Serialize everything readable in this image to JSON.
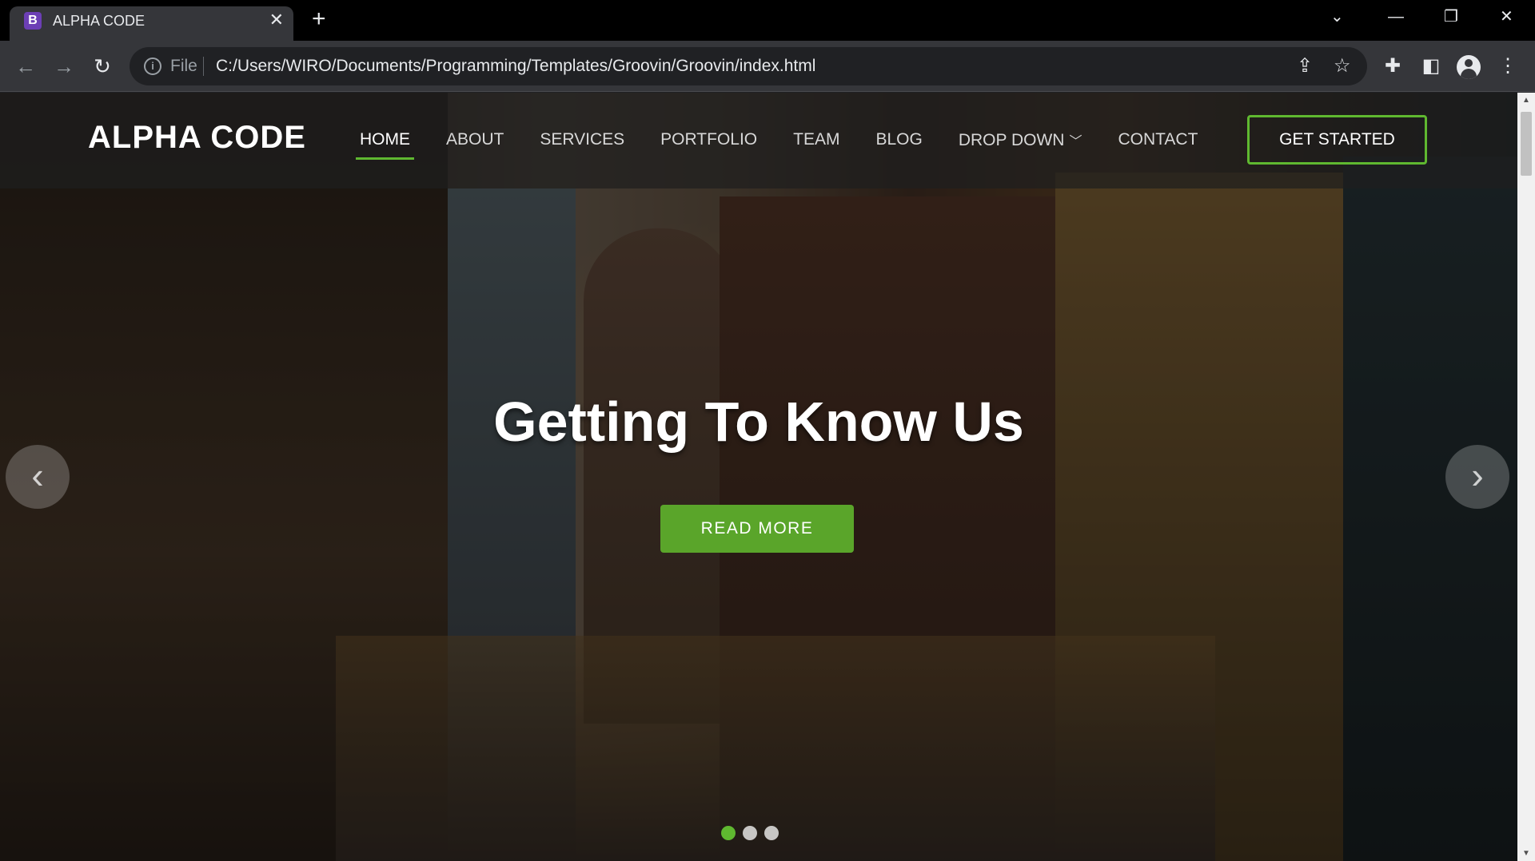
{
  "browser": {
    "tab_title": "ALPHA CODE",
    "tab_favicon_letter": "B",
    "tab_close": "✕",
    "new_tab": "+",
    "url_scheme_label": "File",
    "url": "C:/Users/WIRO/Documents/Programming/Templates/Groovin/Groovin/index.html"
  },
  "site": {
    "logo": "ALPHA CODE",
    "menu": [
      "HOME",
      "ABOUT",
      "SERVICES",
      "PORTFOLIO",
      "TEAM",
      "BLOG",
      "DROP DOWN",
      "CONTACT"
    ],
    "active_menu": "HOME",
    "cta": "GET STARTED"
  },
  "hero": {
    "headline": "Getting To Know Us",
    "button": "READ MORE",
    "slides": 3,
    "active_slide": 1
  },
  "colors": {
    "accent": "#5fb830",
    "button": "#5aa52a"
  }
}
